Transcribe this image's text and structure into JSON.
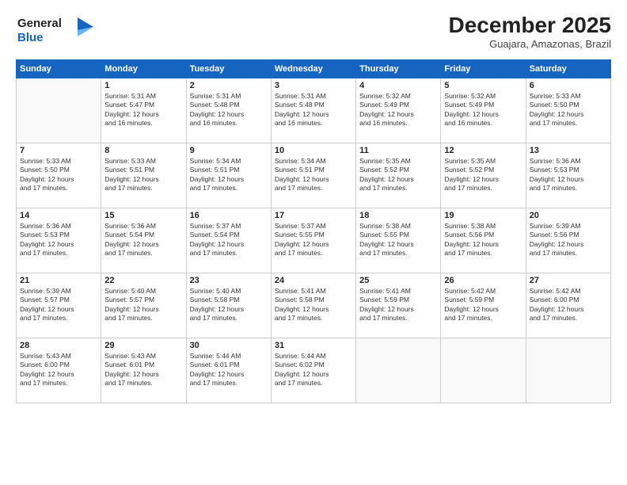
{
  "logo": {
    "line1": "General",
    "line2": "Blue"
  },
  "header": {
    "month": "December 2025",
    "location": "Guajara, Amazonas, Brazil"
  },
  "weekdays": [
    "Sunday",
    "Monday",
    "Tuesday",
    "Wednesday",
    "Thursday",
    "Friday",
    "Saturday"
  ],
  "weeks": [
    [
      {
        "day": "",
        "lines": []
      },
      {
        "day": "1",
        "lines": [
          "Sunrise: 5:31 AM",
          "Sunset: 5:47 PM",
          "Daylight: 12 hours",
          "and 16 minutes."
        ]
      },
      {
        "day": "2",
        "lines": [
          "Sunrise: 5:31 AM",
          "Sunset: 5:48 PM",
          "Daylight: 12 hours",
          "and 16 minutes."
        ]
      },
      {
        "day": "3",
        "lines": [
          "Sunrise: 5:31 AM",
          "Sunset: 5:48 PM",
          "Daylight: 12 hours",
          "and 16 minutes."
        ]
      },
      {
        "day": "4",
        "lines": [
          "Sunrise: 5:32 AM",
          "Sunset: 5:49 PM",
          "Daylight: 12 hours",
          "and 16 minutes."
        ]
      },
      {
        "day": "5",
        "lines": [
          "Sunrise: 5:32 AM",
          "Sunset: 5:49 PM",
          "Daylight: 12 hours",
          "and 16 minutes."
        ]
      },
      {
        "day": "6",
        "lines": [
          "Sunrise: 5:33 AM",
          "Sunset: 5:50 PM",
          "Daylight: 12 hours",
          "and 17 minutes."
        ]
      }
    ],
    [
      {
        "day": "7",
        "lines": [
          "Sunrise: 5:33 AM",
          "Sunset: 5:50 PM",
          "Daylight: 12 hours",
          "and 17 minutes."
        ]
      },
      {
        "day": "8",
        "lines": [
          "Sunrise: 5:33 AM",
          "Sunset: 5:51 PM",
          "Daylight: 12 hours",
          "and 17 minutes."
        ]
      },
      {
        "day": "9",
        "lines": [
          "Sunrise: 5:34 AM",
          "Sunset: 5:51 PM",
          "Daylight: 12 hours",
          "and 17 minutes."
        ]
      },
      {
        "day": "10",
        "lines": [
          "Sunrise: 5:34 AM",
          "Sunset: 5:51 PM",
          "Daylight: 12 hours",
          "and 17 minutes."
        ]
      },
      {
        "day": "11",
        "lines": [
          "Sunrise: 5:35 AM",
          "Sunset: 5:52 PM",
          "Daylight: 12 hours",
          "and 17 minutes."
        ]
      },
      {
        "day": "12",
        "lines": [
          "Sunrise: 5:35 AM",
          "Sunset: 5:52 PM",
          "Daylight: 12 hours",
          "and 17 minutes."
        ]
      },
      {
        "day": "13",
        "lines": [
          "Sunrise: 5:36 AM",
          "Sunset: 5:53 PM",
          "Daylight: 12 hours",
          "and 17 minutes."
        ]
      }
    ],
    [
      {
        "day": "14",
        "lines": [
          "Sunrise: 5:36 AM",
          "Sunset: 5:53 PM",
          "Daylight: 12 hours",
          "and 17 minutes."
        ]
      },
      {
        "day": "15",
        "lines": [
          "Sunrise: 5:36 AM",
          "Sunset: 5:54 PM",
          "Daylight: 12 hours",
          "and 17 minutes."
        ]
      },
      {
        "day": "16",
        "lines": [
          "Sunrise: 5:37 AM",
          "Sunset: 5:54 PM",
          "Daylight: 12 hours",
          "and 17 minutes."
        ]
      },
      {
        "day": "17",
        "lines": [
          "Sunrise: 5:37 AM",
          "Sunset: 5:55 PM",
          "Daylight: 12 hours",
          "and 17 minutes."
        ]
      },
      {
        "day": "18",
        "lines": [
          "Sunrise: 5:38 AM",
          "Sunset: 5:55 PM",
          "Daylight: 12 hours",
          "and 17 minutes."
        ]
      },
      {
        "day": "19",
        "lines": [
          "Sunrise: 5:38 AM",
          "Sunset: 5:56 PM",
          "Daylight: 12 hours",
          "and 17 minutes."
        ]
      },
      {
        "day": "20",
        "lines": [
          "Sunrise: 5:39 AM",
          "Sunset: 5:56 PM",
          "Daylight: 12 hours",
          "and 17 minutes."
        ]
      }
    ],
    [
      {
        "day": "21",
        "lines": [
          "Sunrise: 5:39 AM",
          "Sunset: 5:57 PM",
          "Daylight: 12 hours",
          "and 17 minutes."
        ]
      },
      {
        "day": "22",
        "lines": [
          "Sunrise: 5:40 AM",
          "Sunset: 5:57 PM",
          "Daylight: 12 hours",
          "and 17 minutes."
        ]
      },
      {
        "day": "23",
        "lines": [
          "Sunrise: 5:40 AM",
          "Sunset: 5:58 PM",
          "Daylight: 12 hours",
          "and 17 minutes."
        ]
      },
      {
        "day": "24",
        "lines": [
          "Sunrise: 5:41 AM",
          "Sunset: 5:58 PM",
          "Daylight: 12 hours",
          "and 17 minutes."
        ]
      },
      {
        "day": "25",
        "lines": [
          "Sunrise: 5:41 AM",
          "Sunset: 5:59 PM",
          "Daylight: 12 hours",
          "and 17 minutes."
        ]
      },
      {
        "day": "26",
        "lines": [
          "Sunrise: 5:42 AM",
          "Sunset: 5:59 PM",
          "Daylight: 12 hours",
          "and 17 minutes."
        ]
      },
      {
        "day": "27",
        "lines": [
          "Sunrise: 5:42 AM",
          "Sunset: 6:00 PM",
          "Daylight: 12 hours",
          "and 17 minutes."
        ]
      }
    ],
    [
      {
        "day": "28",
        "lines": [
          "Sunrise: 5:43 AM",
          "Sunset: 6:00 PM",
          "Daylight: 12 hours",
          "and 17 minutes."
        ]
      },
      {
        "day": "29",
        "lines": [
          "Sunrise: 5:43 AM",
          "Sunset: 6:01 PM",
          "Daylight: 12 hours",
          "and 17 minutes."
        ]
      },
      {
        "day": "30",
        "lines": [
          "Sunrise: 5:44 AM",
          "Sunset: 6:01 PM",
          "Daylight: 12 hours",
          "and 17 minutes."
        ]
      },
      {
        "day": "31",
        "lines": [
          "Sunrise: 5:44 AM",
          "Sunset: 6:02 PM",
          "Daylight: 12 hours",
          "and 17 minutes."
        ]
      },
      {
        "day": "",
        "lines": []
      },
      {
        "day": "",
        "lines": []
      },
      {
        "day": "",
        "lines": []
      }
    ]
  ]
}
